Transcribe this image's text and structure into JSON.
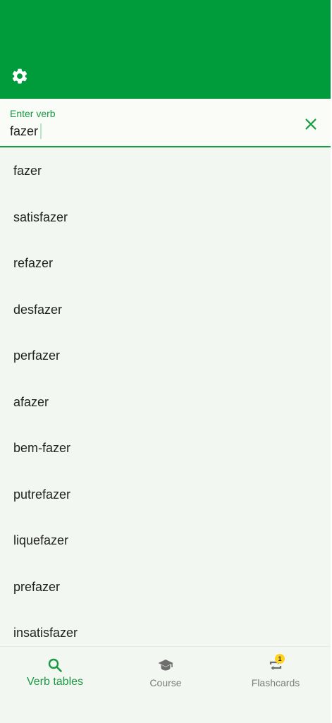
{
  "header": {
    "settings_icon": "gear-icon",
    "color": "#009b3a"
  },
  "search": {
    "label": "Enter verb",
    "value": "fazer",
    "placeholder": "Enter verb",
    "clear_icon": "close-icon",
    "accent_color": "#1a9a44"
  },
  "results": [
    "fazer",
    "satisfazer",
    "refazer",
    "desfazer",
    "perfazer",
    "afazer",
    "bem-fazer",
    "putrefazer",
    "liquefazer",
    "prefazer",
    "insatisfazer"
  ],
  "bottom_nav": {
    "items": [
      {
        "label": "Verb tables",
        "icon": "search-icon",
        "active": true
      },
      {
        "label": "Course",
        "icon": "graduation-cap-icon",
        "active": false
      },
      {
        "label": "Flashcards",
        "icon": "repeat-icon",
        "active": false,
        "badge": "1"
      }
    ],
    "badge_color": "#ffd21f"
  }
}
